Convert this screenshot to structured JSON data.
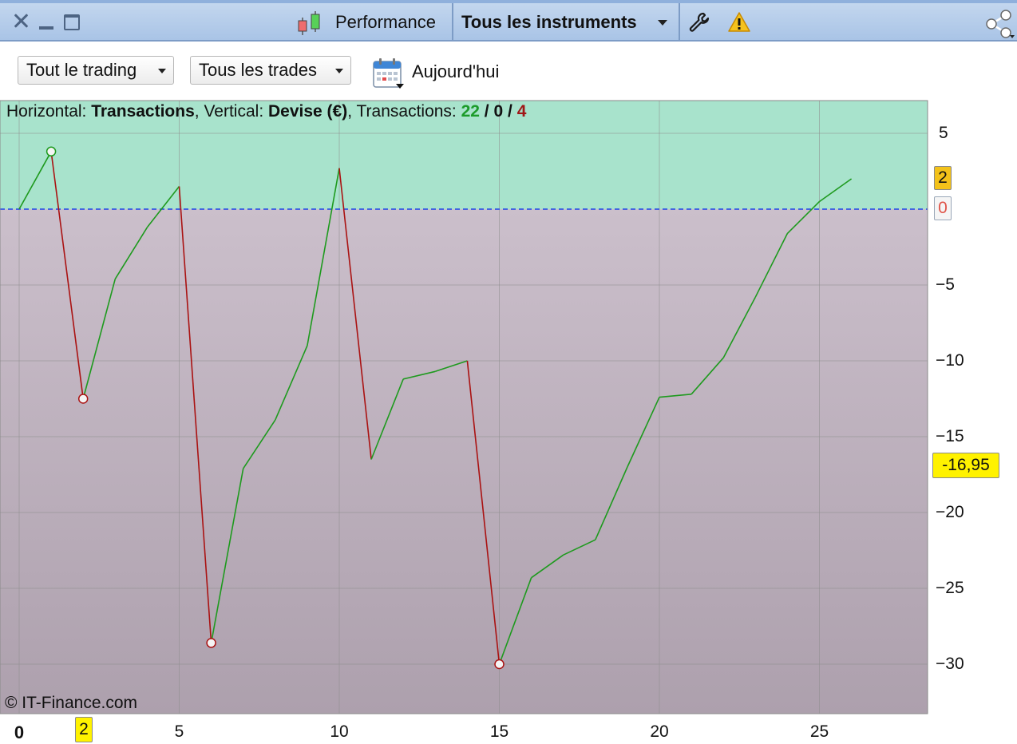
{
  "window": {
    "title": "Performance",
    "instrument_selector": "Tous les instruments",
    "icons": [
      "close-icon",
      "minimize-icon",
      "maximize-icon",
      "candlestick-icon",
      "chevron-down-icon",
      "wrench-icon",
      "warning-icon",
      "share-icon"
    ]
  },
  "toolbar": {
    "scope_select": "Tout le trading",
    "trades_select": "Tous les trades",
    "date_label": "Aujourd'hui"
  },
  "info_bar": {
    "h_label": "Horizontal: ",
    "h_value": "Transactions",
    "v_label": ", Vertical: ",
    "v_value": "Devise (€)",
    "t_label": ", Transactions: ",
    "wins": "22",
    "sep1": " / ",
    "neutral": "0",
    "sep2": " / ",
    "losses": "4"
  },
  "watermark": "© IT-Finance.com",
  "badges": {
    "last_value": "2",
    "zero_value": "0",
    "min_value": "-16,95",
    "x_marker": "2"
  },
  "colors": {
    "profit_zone": "#a8e3cc",
    "loss_zone_top": "#cbbfcb",
    "loss_zone_bottom": "#ada0ad",
    "up_line": "#1e9a1e",
    "down_line": "#aa1212",
    "zero_line": "#1c43e6",
    "badge_yellow": "#fff200",
    "badge_gold": "#f3c21a"
  },
  "chart_data": {
    "type": "line",
    "title": "",
    "xlabel": "",
    "ylabel": "",
    "xlim": [
      -0.6,
      28.4
    ],
    "ylim": [
      -33.3,
      7.2
    ],
    "x_ticks": [
      0,
      5,
      10,
      15,
      20,
      25
    ],
    "x_tick_labels": [
      "0",
      "5",
      "10",
      "15",
      "20",
      "25"
    ],
    "y_ticks": [
      5,
      0,
      -5,
      -10,
      -15,
      -20,
      -25,
      -30
    ],
    "y_tick_labels": [
      "5",
      "",
      "−5",
      "−10",
      "−15",
      "−20",
      "−25",
      "−30"
    ],
    "grid": true,
    "x": [
      0,
      1,
      2,
      3,
      4,
      5,
      6,
      7,
      8,
      9,
      10,
      11,
      12,
      13,
      14,
      15,
      16,
      17,
      18,
      19,
      20,
      21,
      22,
      23,
      24,
      25,
      26
    ],
    "y": [
      0,
      3.8,
      -12.5,
      -4.6,
      -1.2,
      1.5,
      -28.6,
      -17.1,
      -13.9,
      -9.0,
      2.7,
      -16.5,
      -11.2,
      -10.7,
      -10.0,
      -30.0,
      -24.3,
      -22.8,
      -21.8,
      -17.0,
      -12.4,
      -12.2,
      -9.8,
      -5.8,
      -1.6,
      0.5,
      2.0
    ],
    "circle_markers_at_x": [
      1,
      2,
      6,
      15
    ]
  }
}
